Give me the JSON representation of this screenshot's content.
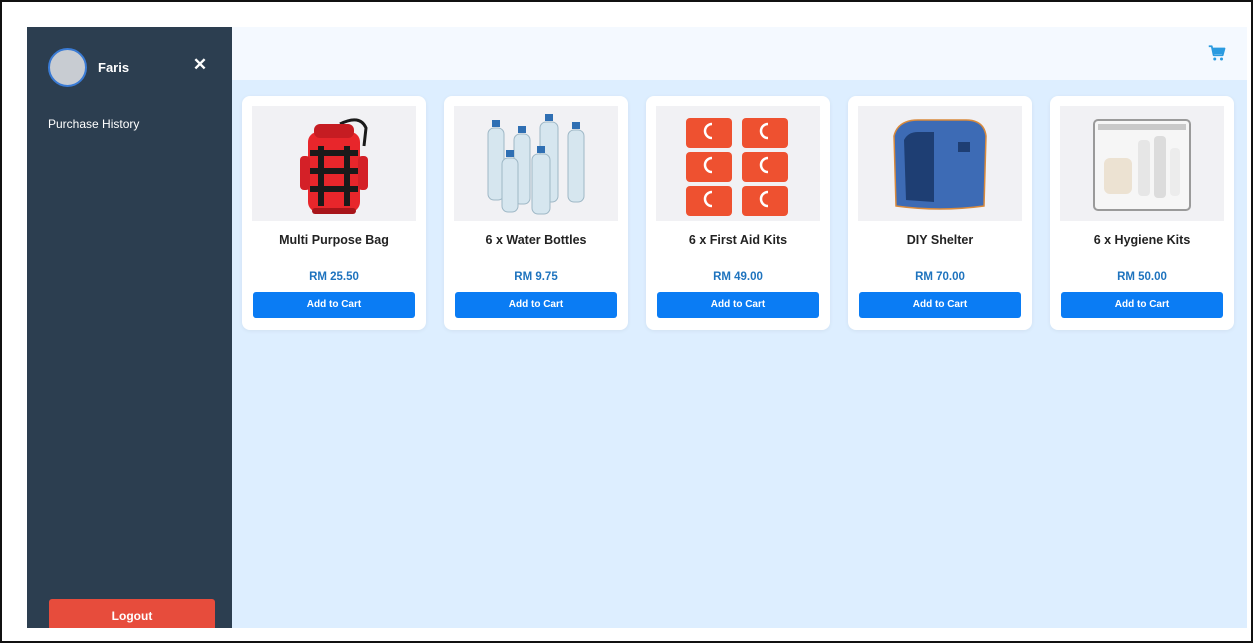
{
  "sidebar": {
    "username": "Faris",
    "close_icon": "close-icon",
    "nav_items": [
      {
        "label": "Purchase History"
      }
    ],
    "logout_label": "Logout",
    "logout_color": "#e74c3c",
    "background": "#2c3e50"
  },
  "header": {
    "cart_icon": "cart-icon",
    "accent": "#0a7cf4"
  },
  "products": [
    {
      "name": "Multi Purpose Bag",
      "price": "RM 25.50",
      "button": "Add to Cart",
      "image": "red-backpack-image"
    },
    {
      "name": "6 x Water Bottles",
      "price": "RM 9.75",
      "button": "Add to Cart",
      "image": "water-bottles-image"
    },
    {
      "name": "6 x First Aid Kits",
      "price": "RM 49.00",
      "button": "Add to Cart",
      "image": "first-aid-kits-image"
    },
    {
      "name": "DIY Shelter",
      "price": "RM 70.00",
      "button": "Add to Cart",
      "image": "blue-shelter-image"
    },
    {
      "name": "6 x Hygiene Kits",
      "price": "RM 50.00",
      "button": "Add to Cart",
      "image": "hygiene-kit-image"
    }
  ]
}
